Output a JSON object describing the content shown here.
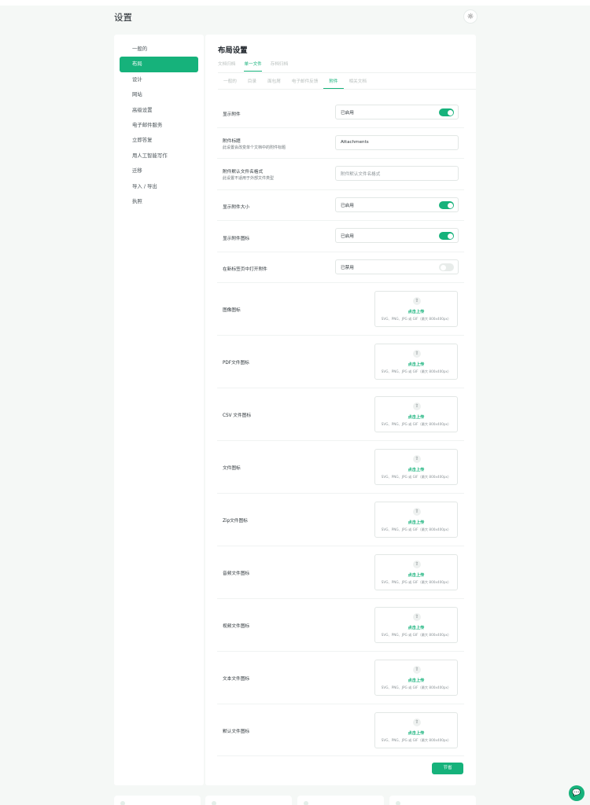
{
  "header": {
    "title": "设置",
    "theme_icon": "sun-icon",
    "theme_glyph": "☼"
  },
  "sidebar": {
    "items": [
      {
        "label": "一般的"
      },
      {
        "label": "布局"
      },
      {
        "label": "设计"
      },
      {
        "label": "网站"
      },
      {
        "label": "高级设置"
      },
      {
        "label": "电子邮件服务"
      },
      {
        "label": "立即答复"
      },
      {
        "label": "用人工智能写作"
      },
      {
        "label": "迁移"
      },
      {
        "label": "导入 / 导出"
      },
      {
        "label": "执照"
      }
    ],
    "active_index": 1
  },
  "main": {
    "title": "布局设置",
    "tabs": [
      {
        "label": "文档归档"
      },
      {
        "label": "单一文件"
      },
      {
        "label": "存档归档"
      }
    ],
    "subtabs": [
      {
        "label": "一般的"
      },
      {
        "label": "目录"
      },
      {
        "label": "面包屑"
      },
      {
        "label": "电子邮件反馈"
      },
      {
        "label": "附件"
      },
      {
        "label": "相关文档"
      }
    ],
    "settings": [
      {
        "label": "显示附件",
        "desc": "",
        "type": "toggle",
        "value": "已启用",
        "on": true
      },
      {
        "label": "附件标题",
        "desc": "此设置会改变单个文档中的附件标题",
        "type": "input",
        "value": "Attachments",
        "placeholder": ""
      },
      {
        "label": "附件默认文件名格式",
        "desc": "此设置不适用于外部文件类型",
        "type": "input",
        "value": "",
        "placeholder": "附件默认文件名格式"
      },
      {
        "label": "显示附件大小",
        "desc": "",
        "type": "toggle",
        "value": "已启用",
        "on": true
      },
      {
        "label": "显示附件图标",
        "desc": "",
        "type": "toggle",
        "value": "已启用",
        "on": true
      },
      {
        "label": "在新标签页中打开附件",
        "desc": "",
        "type": "toggle",
        "value": "已禁用",
        "on": false
      }
    ],
    "upload_rows": [
      {
        "label": "图像图标"
      },
      {
        "label": "PDF文件图标"
      },
      {
        "label": "CSV 文件图标"
      },
      {
        "label": "文件图标"
      },
      {
        "label": "Zip文件图标"
      },
      {
        "label": "音频文件图标"
      },
      {
        "label": "视频文件图标"
      },
      {
        "label": "文本文件图标"
      },
      {
        "label": "默认文件图标"
      }
    ],
    "upload": {
      "icon": "upload-cloud-icon",
      "glyph": "⇧",
      "main_text": "点击上传",
      "hint": "SVG、PNG、JPG 或 GIF（最大 800x400px）"
    },
    "save_label": "节省"
  },
  "chat": {
    "icon": "chat-bubble-icon",
    "glyph": "💬"
  },
  "colors": {
    "accent": "#16b27b",
    "background": "#f5f8f6"
  }
}
